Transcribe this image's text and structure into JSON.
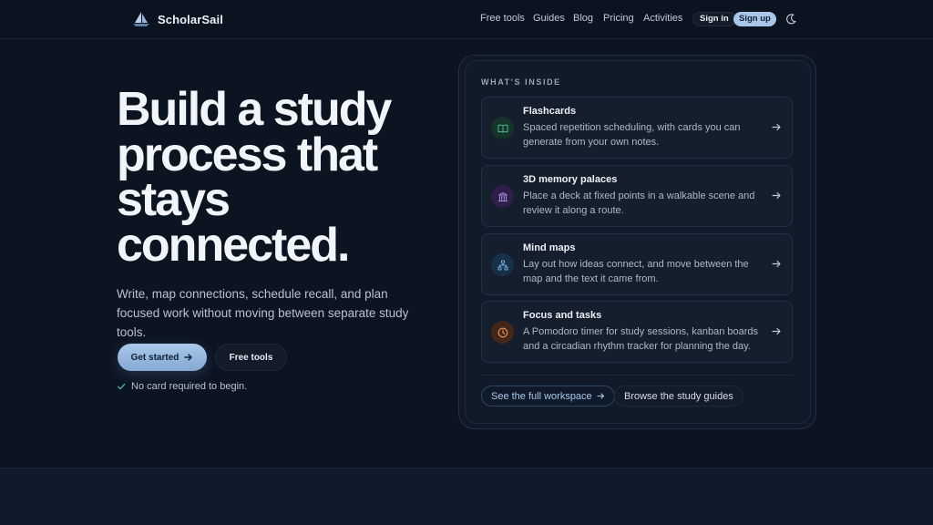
{
  "header": {
    "brand": "ScholarSail",
    "nav": [
      "Free tools",
      "Guides",
      "Blog",
      "Pricing",
      "Activities"
    ],
    "sign_in": "Sign in",
    "sign_up": "Sign up",
    "theme_icon": "moon-icon"
  },
  "hero": {
    "title_lines": [
      "Build a study",
      "process that",
      "stays",
      "connected."
    ],
    "subtitle": "Write, map connections, schedule recall, and plan focused work without moving between separate study tools.",
    "primary_cta": "Get started",
    "secondary_cta": "Free tools",
    "note": "No card required to begin."
  },
  "card": {
    "label": "WHAT'S INSIDE",
    "features": [
      {
        "title": "Flashcards",
        "desc": "Spaced repetition scheduling, with cards you can generate from your own notes.",
        "icon": "book-icon",
        "color": "#4fb39a",
        "bg": "#143429"
      },
      {
        "title": "3D memory palaces",
        "desc": "Place a deck at fixed points in a walkable scene and review it along a route.",
        "icon": "building-icon",
        "color": "#b58fe0",
        "bg": "#2d1f4a"
      },
      {
        "title": "Mind maps",
        "desc": "Lay out how ideas connect, and move between the map and the text it came from.",
        "icon": "network-icon",
        "color": "#7fb0e3",
        "bg": "#17304a"
      },
      {
        "title": "Focus and tasks",
        "desc": "A Pomodoro timer for study sessions, kanban boards and a circadian rhythm tracker for planning the day.",
        "icon": "clock-icon",
        "color": "#e69a58",
        "bg": "#45271a"
      }
    ],
    "link_primary": "See the full workspace",
    "link_secondary": "Browse the study guides"
  },
  "colors": {
    "accent": "#a9c8ea",
    "background": "#0c1422"
  }
}
